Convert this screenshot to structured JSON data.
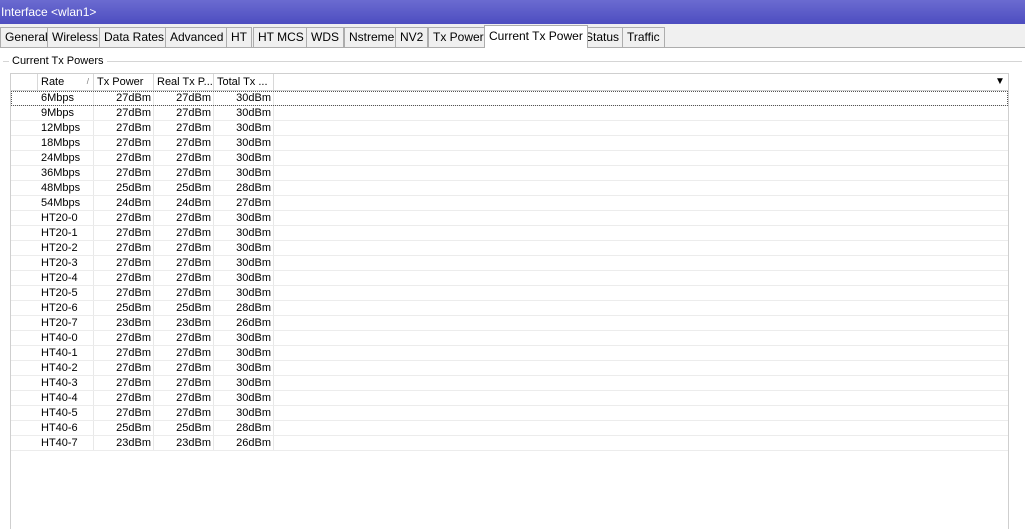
{
  "window": {
    "title": "Interface <wlan1>"
  },
  "tabs": [
    {
      "label": "General"
    },
    {
      "label": "Wireless"
    },
    {
      "label": "Data Rates"
    },
    {
      "label": "Advanced"
    },
    {
      "label": "HT"
    },
    {
      "label": "HT MCS"
    },
    {
      "label": "WDS"
    },
    {
      "label": "Nstreme"
    },
    {
      "label": "NV2"
    },
    {
      "label": "Tx Power"
    },
    {
      "label": "Current Tx Power"
    },
    {
      "label": "Status"
    },
    {
      "label": "Traffic"
    }
  ],
  "active_tab": "Current Tx Power",
  "group": {
    "label": "Current Tx Powers"
  },
  "table": {
    "columns": [
      "Rate",
      "Tx Power",
      "Real Tx P...",
      "Total Tx ..."
    ],
    "sort_indicator": "/",
    "dropdown_icon": "▼",
    "rows": [
      {
        "rate": "6Mbps",
        "tx": "27dBm",
        "real": "27dBm",
        "total": "30dBm"
      },
      {
        "rate": "9Mbps",
        "tx": "27dBm",
        "real": "27dBm",
        "total": "30dBm"
      },
      {
        "rate": "12Mbps",
        "tx": "27dBm",
        "real": "27dBm",
        "total": "30dBm"
      },
      {
        "rate": "18Mbps",
        "tx": "27dBm",
        "real": "27dBm",
        "total": "30dBm"
      },
      {
        "rate": "24Mbps",
        "tx": "27dBm",
        "real": "27dBm",
        "total": "30dBm"
      },
      {
        "rate": "36Mbps",
        "tx": "27dBm",
        "real": "27dBm",
        "total": "30dBm"
      },
      {
        "rate": "48Mbps",
        "tx": "25dBm",
        "real": "25dBm",
        "total": "28dBm"
      },
      {
        "rate": "54Mbps",
        "tx": "24dBm",
        "real": "24dBm",
        "total": "27dBm"
      },
      {
        "rate": "HT20-0",
        "tx": "27dBm",
        "real": "27dBm",
        "total": "30dBm"
      },
      {
        "rate": "HT20-1",
        "tx": "27dBm",
        "real": "27dBm",
        "total": "30dBm"
      },
      {
        "rate": "HT20-2",
        "tx": "27dBm",
        "real": "27dBm",
        "total": "30dBm"
      },
      {
        "rate": "HT20-3",
        "tx": "27dBm",
        "real": "27dBm",
        "total": "30dBm"
      },
      {
        "rate": "HT20-4",
        "tx": "27dBm",
        "real": "27dBm",
        "total": "30dBm"
      },
      {
        "rate": "HT20-5",
        "tx": "27dBm",
        "real": "27dBm",
        "total": "30dBm"
      },
      {
        "rate": "HT20-6",
        "tx": "25dBm",
        "real": "25dBm",
        "total": "28dBm"
      },
      {
        "rate": "HT20-7",
        "tx": "23dBm",
        "real": "23dBm",
        "total": "26dBm"
      },
      {
        "rate": "HT40-0",
        "tx": "27dBm",
        "real": "27dBm",
        "total": "30dBm"
      },
      {
        "rate": "HT40-1",
        "tx": "27dBm",
        "real": "27dBm",
        "total": "30dBm"
      },
      {
        "rate": "HT40-2",
        "tx": "27dBm",
        "real": "27dBm",
        "total": "30dBm"
      },
      {
        "rate": "HT40-3",
        "tx": "27dBm",
        "real": "27dBm",
        "total": "30dBm"
      },
      {
        "rate": "HT40-4",
        "tx": "27dBm",
        "real": "27dBm",
        "total": "30dBm"
      },
      {
        "rate": "HT40-5",
        "tx": "27dBm",
        "real": "27dBm",
        "total": "30dBm"
      },
      {
        "rate": "HT40-6",
        "tx": "25dBm",
        "real": "25dBm",
        "total": "28dBm"
      },
      {
        "rate": "HT40-7",
        "tx": "23dBm",
        "real": "23dBm",
        "total": "26dBm"
      }
    ]
  }
}
